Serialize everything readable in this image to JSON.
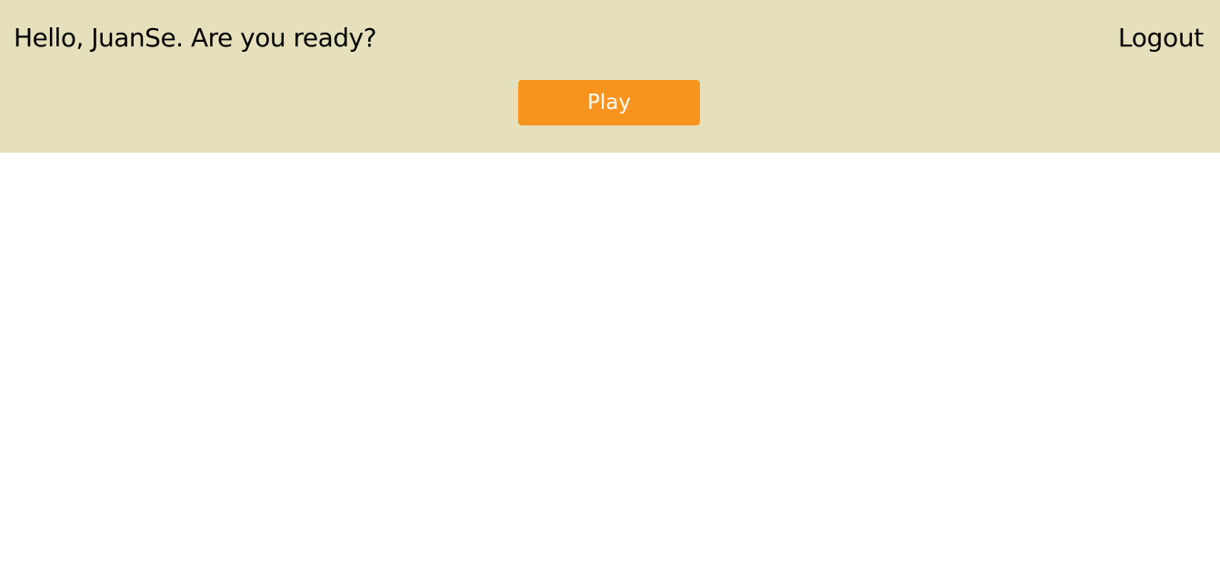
{
  "header": {
    "greeting": "Hello, JuanSe. Are you ready?",
    "logout_label": "Logout",
    "play_label": "Play"
  },
  "colors": {
    "header_background": "#e5e0bb",
    "play_button": "#f7941e",
    "play_text": "#ffffff",
    "page_background": "#ffffff"
  }
}
